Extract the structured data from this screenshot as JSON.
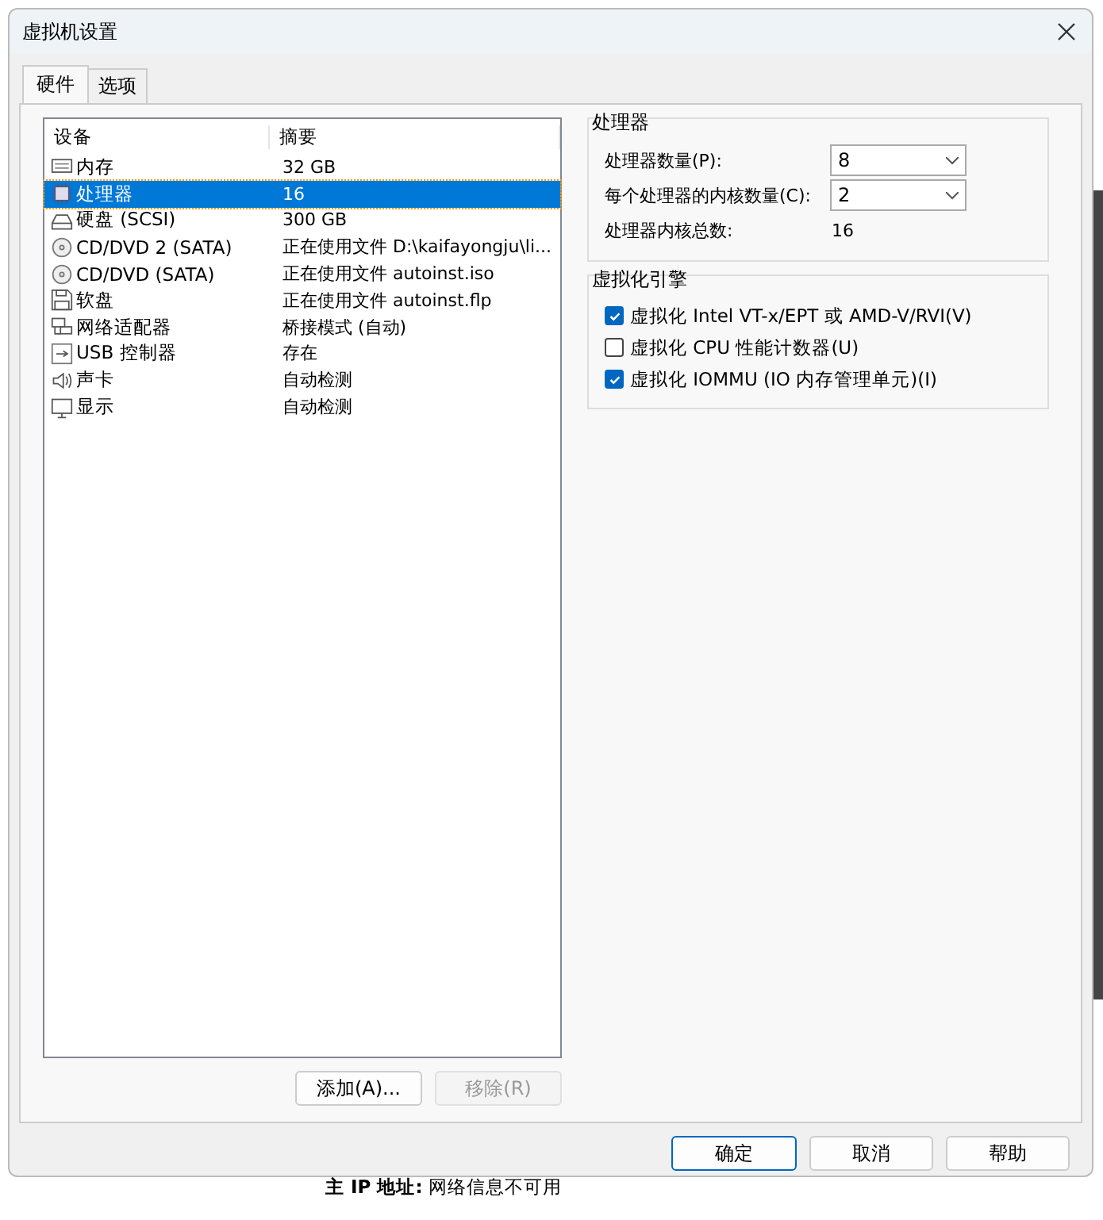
{
  "window": {
    "title": "虚拟机设置"
  },
  "tabs": [
    {
      "label": "硬件",
      "selected": true
    },
    {
      "label": "选项",
      "selected": false
    }
  ],
  "device_table": {
    "columns": [
      "设备",
      "摘要"
    ],
    "rows": [
      {
        "kind": "memory",
        "device": "内存",
        "summary": "32 GB",
        "selected": false
      },
      {
        "kind": "cpu",
        "device": "处理器",
        "summary": "16",
        "selected": true
      },
      {
        "kind": "disk",
        "device": "硬盘 (SCSI)",
        "summary": "300 GB",
        "selected": false
      },
      {
        "kind": "cd",
        "device": "CD/DVD 2 (SATA)",
        "summary": "正在使用文件 D:\\kaifayongju\\li...",
        "selected": false
      },
      {
        "kind": "cd",
        "device": "CD/DVD (SATA)",
        "summary": "正在使用文件 autoinst.iso",
        "selected": false
      },
      {
        "kind": "floppy",
        "device": "软盘",
        "summary": "正在使用文件 autoinst.flp",
        "selected": false
      },
      {
        "kind": "network",
        "device": "网络适配器",
        "summary": "桥接模式 (自动)",
        "selected": false
      },
      {
        "kind": "usb",
        "device": "USB 控制器",
        "summary": "存在",
        "selected": false
      },
      {
        "kind": "sound",
        "device": "声卡",
        "summary": "自动检测",
        "selected": false
      },
      {
        "kind": "display",
        "device": "显示",
        "summary": "自动检测",
        "selected": false
      }
    ]
  },
  "list_buttons": [
    {
      "label": "添加(A)...",
      "disabled": false
    },
    {
      "label": "移除(R)",
      "disabled": true
    }
  ],
  "processor_group": {
    "title": "处理器",
    "fields": [
      {
        "label": "处理器数量(P):",
        "value": "8"
      },
      {
        "label": "每个处理器的内核数量(C):",
        "value": "2"
      }
    ],
    "total_label": "处理器内核总数:",
    "total_value": "16"
  },
  "virtualization_group": {
    "title": "虚拟化引擎",
    "options": [
      {
        "label": "虚拟化 Intel VT-x/EPT 或 AMD-V/RVI(V)",
        "checked": true
      },
      {
        "label": "虚拟化 CPU 性能计数器(U)",
        "checked": false
      },
      {
        "label": "虚拟化 IOMMU (IO 内存管理单元)(I)",
        "checked": true
      }
    ]
  },
  "dialog_buttons": [
    {
      "label": "确定",
      "default": true
    },
    {
      "label": "取消",
      "default": false
    },
    {
      "label": "帮助",
      "default": false
    }
  ],
  "background_text": "**主 IP 地址:** 网络信息不可用"
}
